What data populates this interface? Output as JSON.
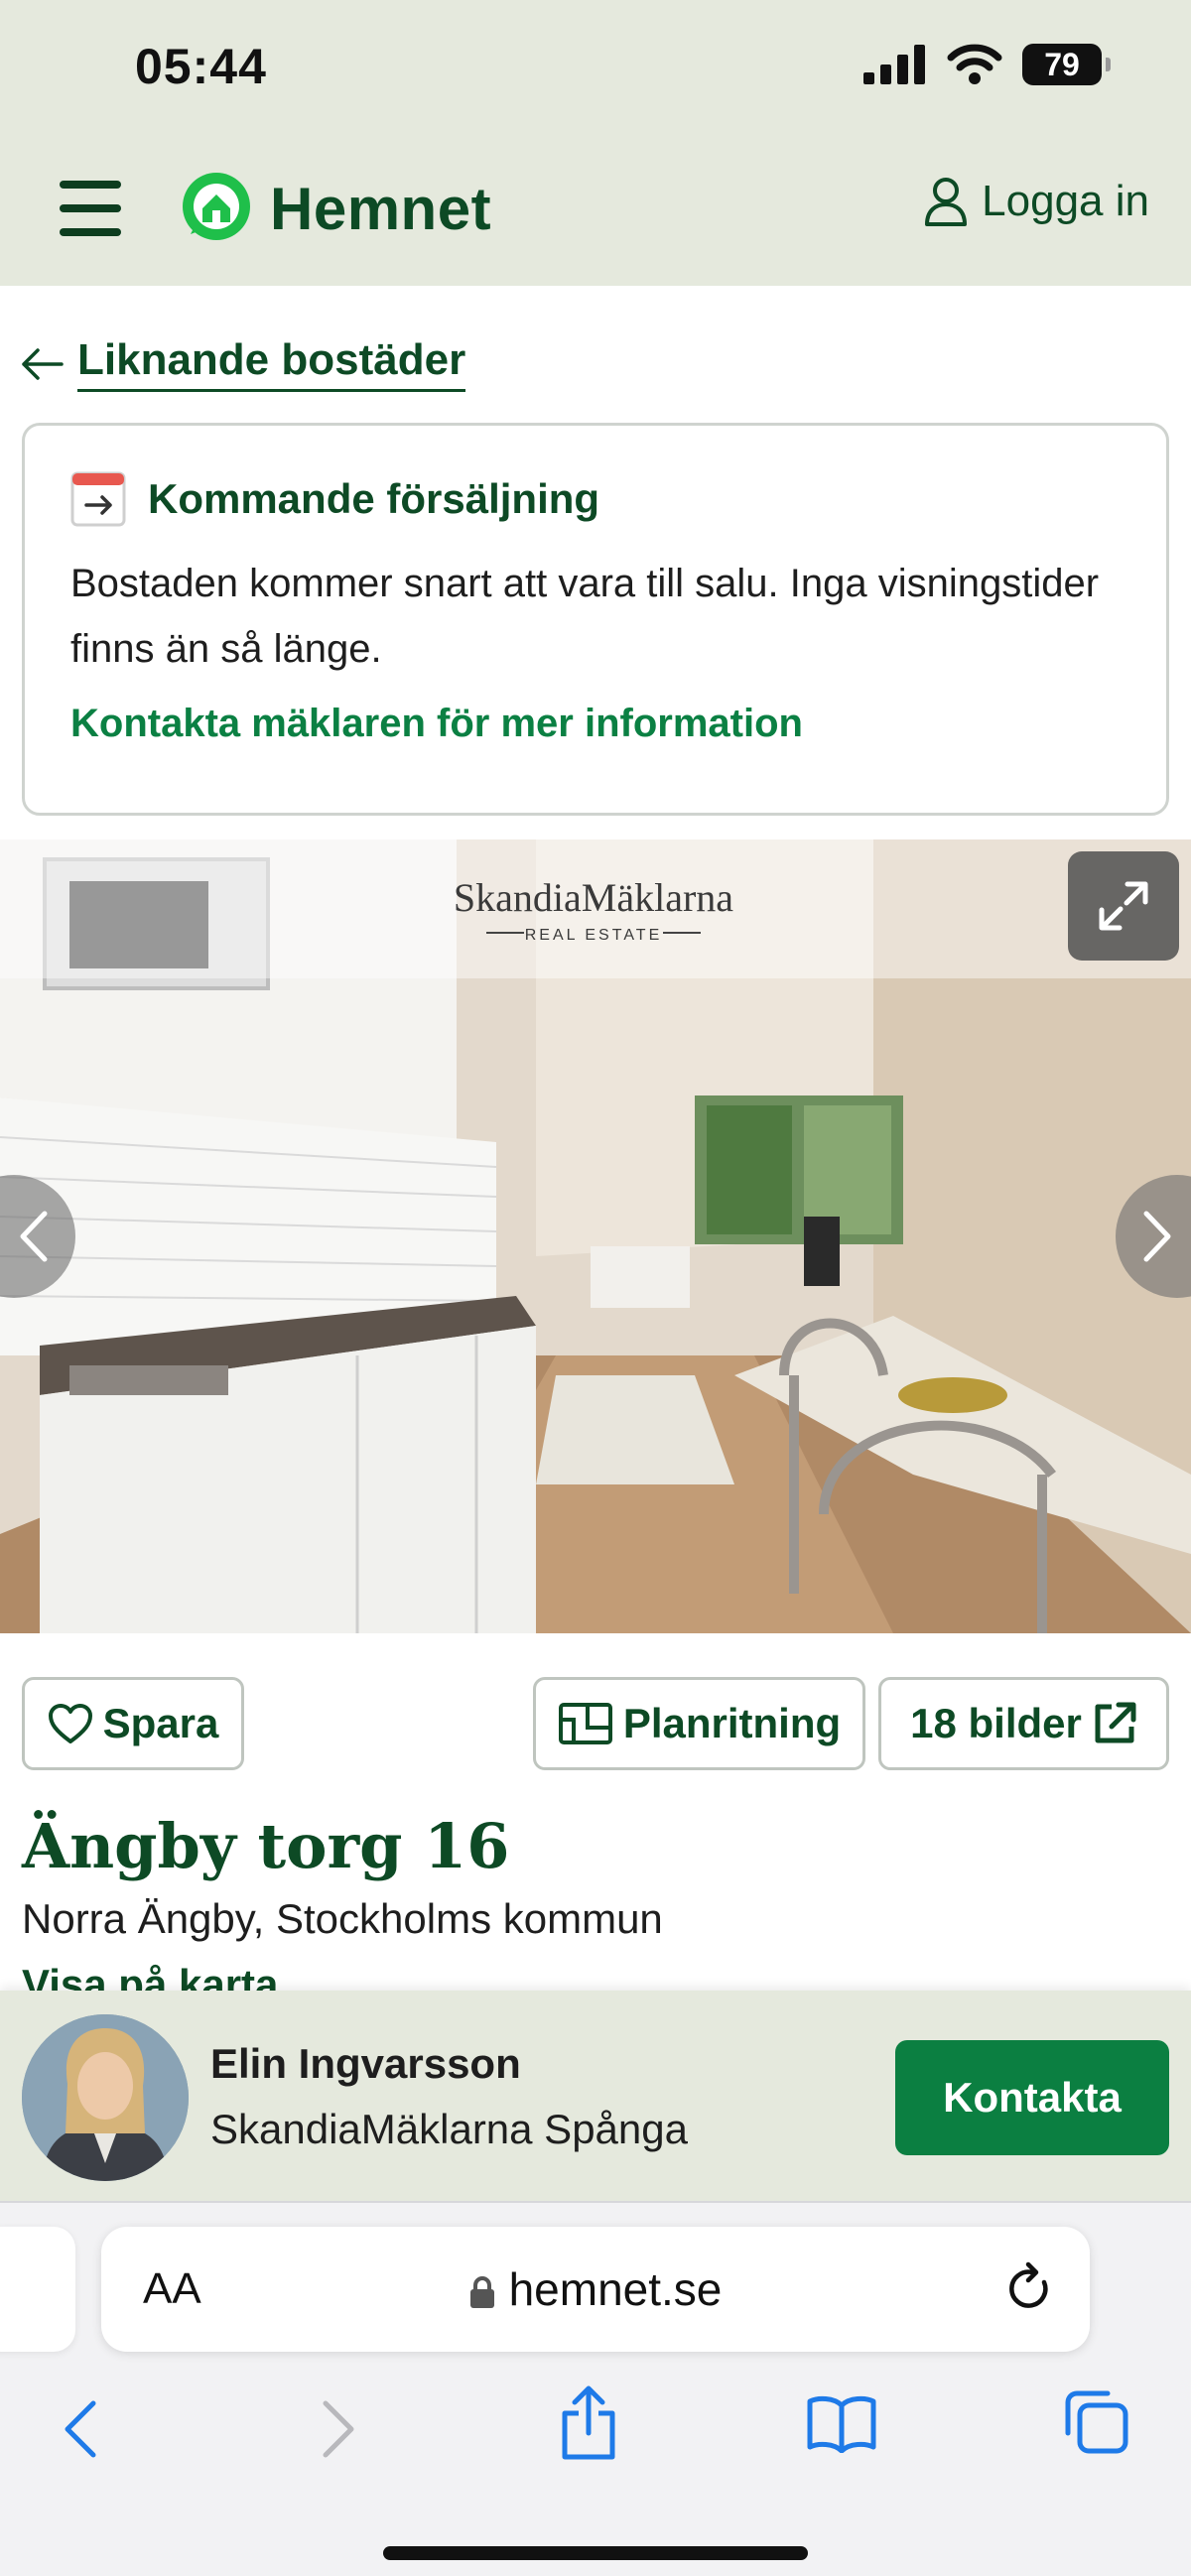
{
  "status": {
    "time": "05:44",
    "battery": "79"
  },
  "header": {
    "logo_text": "Hemnet",
    "login_label": "Logga in"
  },
  "back_link": {
    "label": "Liknande bostäder"
  },
  "notice": {
    "title": "Kommande försäljning",
    "body": "Bostaden kommer snart att vara till salu. Inga visningstider finns än så länge.",
    "link": "Kontakta mäklaren för mer information"
  },
  "photo": {
    "watermark_brand": "SkandiaMäklarna",
    "watermark_sub": "REAL ESTATE"
  },
  "actions": {
    "save_label": "Spara",
    "floorplan_label": "Planritning",
    "images_label": "18 bilder"
  },
  "listing": {
    "address": "Ängby torg 16",
    "area": "Norra Ängby, Stockholms kommun",
    "map_link": "Visa på karta"
  },
  "agent": {
    "name": "Elin Ingvarsson",
    "company": "SkandiaMäklarna Spånga",
    "contact_label": "Kontakta"
  },
  "browser": {
    "text_size_label": "AA",
    "domain": "hemnet.se"
  },
  "colors": {
    "brand_green": "#0d4a25",
    "accent_green": "#0b7f41",
    "header_bg": "#e5e9dd"
  }
}
